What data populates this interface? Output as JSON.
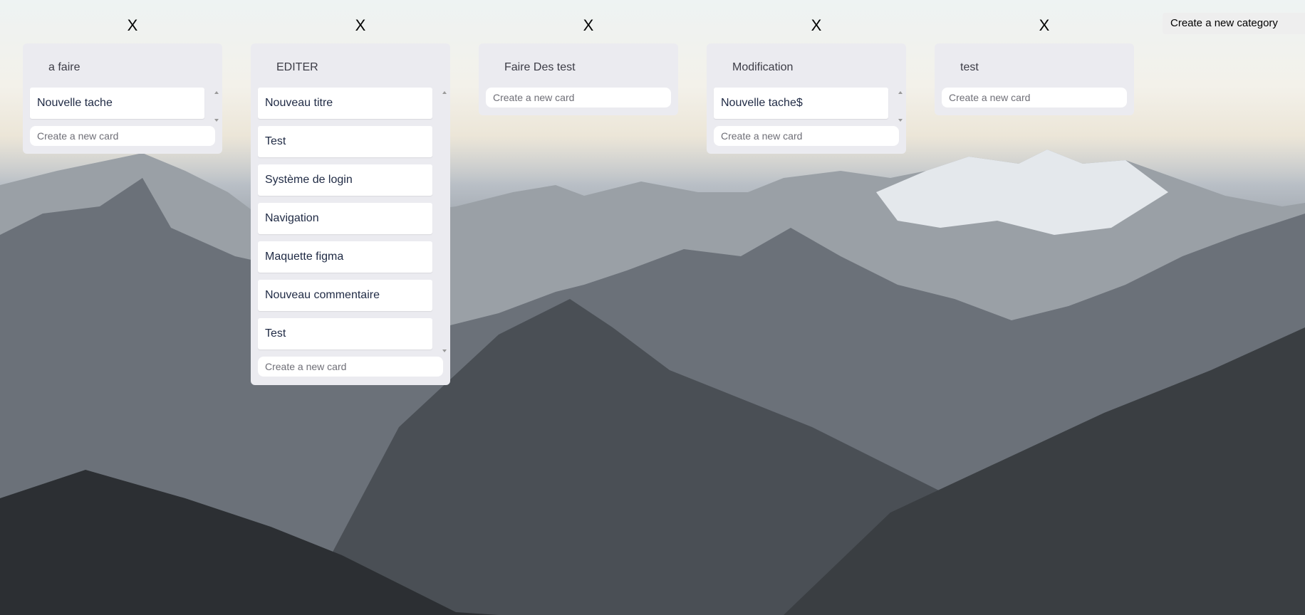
{
  "header": {
    "create_category_label": "Create a new category",
    "close_label": "X"
  },
  "columns": [
    {
      "title": "a faire",
      "cards": [
        "Nouvelle tache"
      ],
      "new_card_placeholder": "Create a new card"
    },
    {
      "title": "EDITER",
      "cards": [
        "Nouveau titre",
        "Test",
        "Système de login",
        "Navigation",
        "Maquette figma",
        "Nouveau commentaire",
        "Test"
      ],
      "new_card_placeholder": "Create a new card"
    },
    {
      "title": "Faire Des test",
      "cards": [],
      "new_card_placeholder": "Create a new card"
    },
    {
      "title": "Modification",
      "cards": [
        "Nouvelle tache$"
      ],
      "new_card_placeholder": "Create a new card"
    },
    {
      "title": "test",
      "cards": [],
      "new_card_placeholder": "Create a new card"
    }
  ],
  "colors": {
    "column_bg": "#ebebf0",
    "card_text": "#1f2a44",
    "title_text": "#3c3c46"
  },
  "icons": {
    "close": "close-icon",
    "scroll_up": "scroll-up-icon",
    "scroll_down": "scroll-down-icon"
  }
}
